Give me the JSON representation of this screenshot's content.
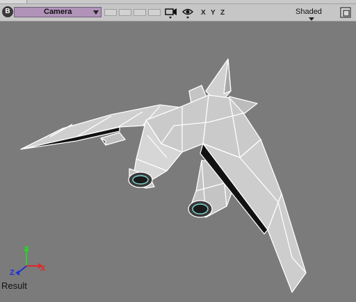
{
  "toolbar": {
    "b_button": "B",
    "camera": "Camera",
    "axes": [
      "X",
      "Y",
      "Z"
    ],
    "shade_mode": "Shaded"
  },
  "icons": {
    "camera": "camera-icon",
    "eye": "eye-icon",
    "maximize": "maximize-icon",
    "axis_gizmo": "axis-gizmo-icon"
  },
  "gizmo": {
    "x": "X",
    "y": "Y",
    "z": "Z"
  },
  "viewport": {
    "label": "Result"
  },
  "colors": {
    "viewport_bg": "#7b7b7b",
    "toolbar_bg": "#c6c6c6",
    "camera_bg": "#b193b9",
    "gizmo_x": "#e0282a",
    "gizmo_y": "#2ad12c",
    "gizmo_z": "#2230d6"
  }
}
